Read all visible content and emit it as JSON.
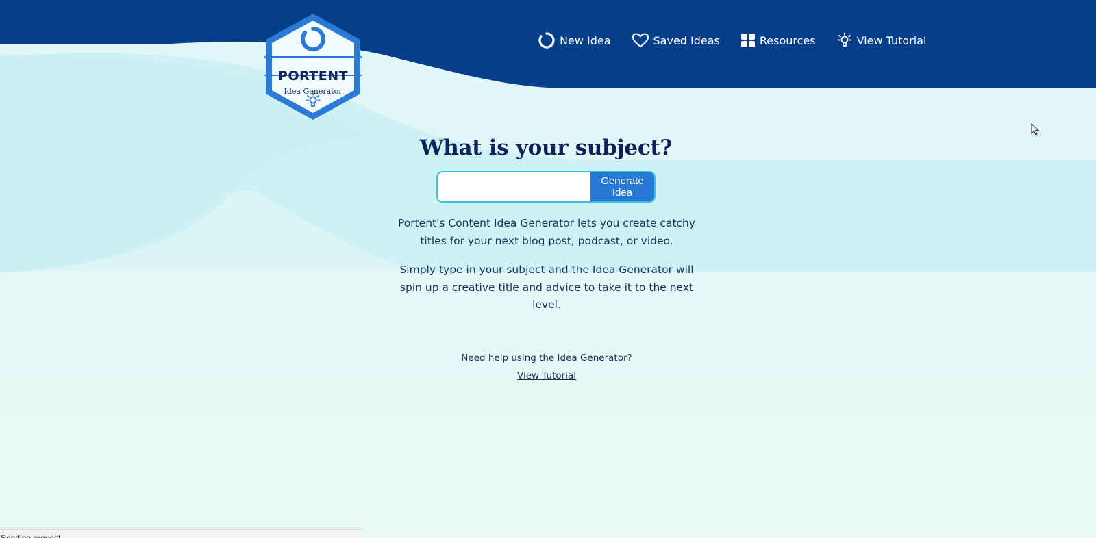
{
  "colors": {
    "header_navy": "#053f8a",
    "button_blue": "#2878d6",
    "input_border": "#35c4d6",
    "headline_text": "#0d2257",
    "body_text": "#1d2f5c"
  },
  "logo": {
    "title": "PORTENT",
    "subtitle": "Idea Generator",
    "icons": [
      "ring-icon",
      "lightbulb-icon"
    ]
  },
  "nav": {
    "items": [
      {
        "label": "New Idea",
        "icon": "ring-icon"
      },
      {
        "label": "Saved Ideas",
        "icon": "heart-icon"
      },
      {
        "label": "Resources",
        "icon": "grid-icon"
      },
      {
        "label": "View Tutorial",
        "icon": "lightbulb-icon"
      }
    ]
  },
  "main": {
    "headline": "What is your subject?",
    "input": {
      "value": "",
      "placeholder": ""
    },
    "generate_label": "Generate Idea",
    "description_1": "Portent's Content Idea Generator lets you create catchy titles for your next blog post, podcast, or video.",
    "description_2": "Simply type in your subject and the Idea Generator will spin up a creative title and advice to take it to the next level.",
    "help_text": "Need help using the Idea Generator?",
    "help_link": "View Tutorial"
  },
  "status_bar": {
    "text": "Sending request..."
  }
}
